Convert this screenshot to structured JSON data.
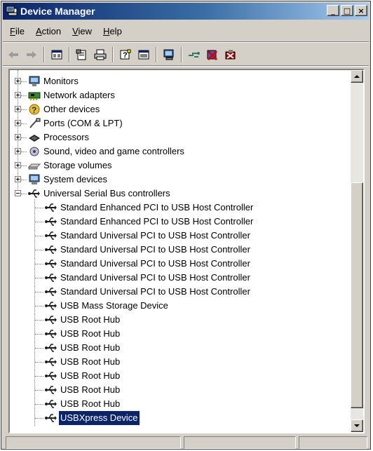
{
  "window": {
    "title": "Device Manager"
  },
  "caption_buttons": {
    "minimize": "_",
    "maximize": "□",
    "close": "×"
  },
  "menu": [
    {
      "label": "File",
      "accel": "F",
      "rest": "ile"
    },
    {
      "label": "Action",
      "accel": "A",
      "rest": "ction"
    },
    {
      "label": "View",
      "accel": "V",
      "rest": "iew"
    },
    {
      "label": "Help",
      "accel": "H",
      "rest": "elp"
    }
  ],
  "toolbar": {
    "buttons": [
      "back-arrow-icon",
      "forward-arrow-icon",
      "show-hide-console-tree-icon",
      "properties-icon",
      "print-icon",
      "help-icon",
      "view-icon",
      "scan-hardware-icon",
      "update-driver-icon",
      "uninstall-icon",
      "disable-device-icon"
    ]
  },
  "tree": {
    "categories": [
      {
        "label": "Monitors",
        "icon": "monitor-icon"
      },
      {
        "label": "Network adapters",
        "icon": "network-adapter-icon"
      },
      {
        "label": "Other devices",
        "icon": "unknown-device-icon"
      },
      {
        "label": "Ports (COM & LPT)",
        "icon": "port-icon"
      },
      {
        "label": "Processors",
        "icon": "processor-icon"
      },
      {
        "label": "Sound, video and game controllers",
        "icon": "sound-icon"
      },
      {
        "label": "Storage volumes",
        "icon": "storage-volume-icon"
      },
      {
        "label": "System devices",
        "icon": "system-device-icon"
      }
    ],
    "expanded": {
      "label": "Universal Serial Bus controllers",
      "icon": "usb-icon"
    },
    "children": [
      {
        "label": "Standard Enhanced PCI to USB Host Controller"
      },
      {
        "label": "Standard Enhanced PCI to USB Host Controller"
      },
      {
        "label": "Standard Universal PCI to USB Host Controller"
      },
      {
        "label": "Standard Universal PCI to USB Host Controller"
      },
      {
        "label": "Standard Universal PCI to USB Host Controller"
      },
      {
        "label": "Standard Universal PCI to USB Host Controller"
      },
      {
        "label": "Standard Universal PCI to USB Host Controller"
      },
      {
        "label": "USB Mass Storage Device"
      },
      {
        "label": "USB Root Hub"
      },
      {
        "label": "USB Root Hub"
      },
      {
        "label": "USB Root Hub"
      },
      {
        "label": "USB Root Hub"
      },
      {
        "label": "USB Root Hub"
      },
      {
        "label": "USB Root Hub"
      },
      {
        "label": "USB Root Hub"
      },
      {
        "label": "USBXpress Device",
        "selected": true
      }
    ]
  },
  "colors": {
    "selection": "#0a246a",
    "title_gradient_start": "#0a246a",
    "title_gradient_end": "#a6caf0",
    "face": "#d4d0c8"
  }
}
